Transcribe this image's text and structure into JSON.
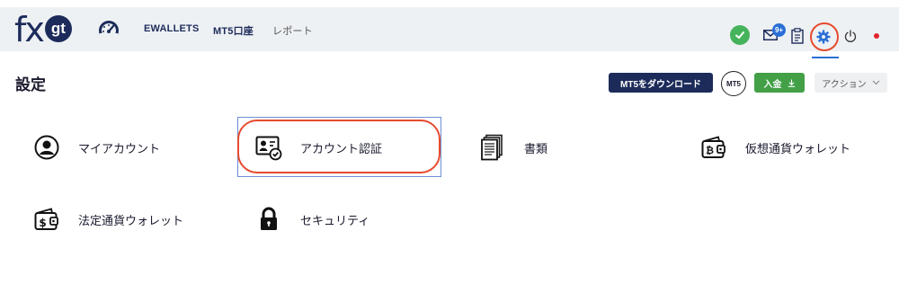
{
  "brand": {
    "logo_fx": "fx",
    "logo_gt": "gt"
  },
  "nav": {
    "items": [
      {
        "label": "EWALLETS"
      },
      {
        "label": "MT5口座"
      },
      {
        "label": "レポート"
      }
    ]
  },
  "topbar_icons": {
    "status": "check-icon",
    "mail": "mail-icon",
    "mail_badge": "9+",
    "clipboard": "clipboard-icon",
    "settings": "gear-icon",
    "power": "power-icon",
    "language": "japan-flag-icon"
  },
  "page": {
    "title": "設定"
  },
  "actions": {
    "download_label": "MT5をダウンロード",
    "mt5_label": "MT5",
    "deposit_label": "入金",
    "action_label": "アクション"
  },
  "settings_items": [
    {
      "label": "マイアカウント",
      "icon": "user-circle-icon"
    },
    {
      "label": "アカウント認証",
      "icon": "id-card-check-icon"
    },
    {
      "label": "書類",
      "icon": "documents-icon"
    },
    {
      "label": "仮想通貨ウォレット",
      "icon": "crypto-wallet-icon"
    },
    {
      "label": "法定通貨ウォレット",
      "icon": "fiat-wallet-icon"
    },
    {
      "label": "セキュリティ",
      "icon": "lock-icon"
    }
  ],
  "colors": {
    "brand_navy": "#1c2b5a",
    "success_green": "#45b35c",
    "deposit_green": "#43a047",
    "highlight_red": "#e64a2e",
    "link_blue": "#2b6fd6"
  }
}
